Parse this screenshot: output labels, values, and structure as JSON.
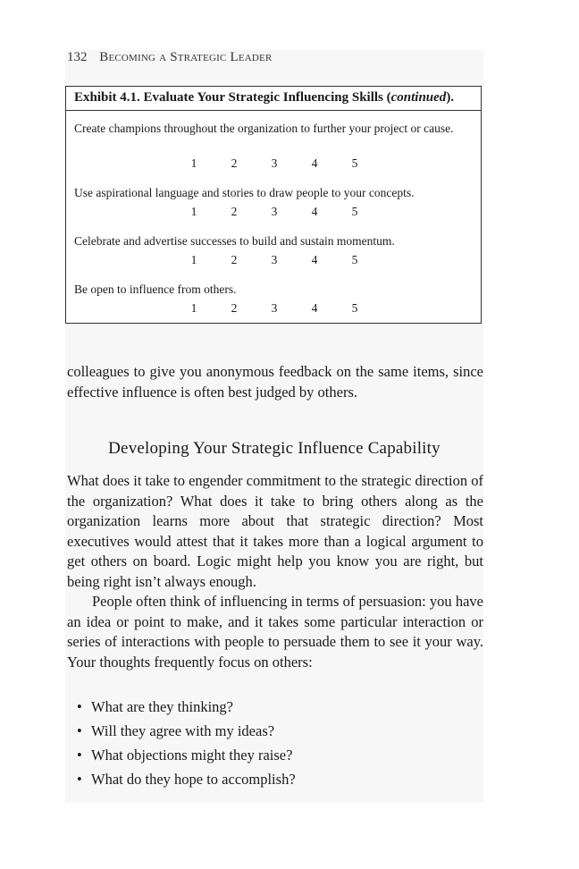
{
  "running_head": {
    "page_number": "132",
    "title": "Becoming a Strategic Leader"
  },
  "exhibit": {
    "title_main": "Exhibit 4.1.  Evaluate Your Strategic Influencing Skills (",
    "title_italic": "continued",
    "title_end": ").",
    "scale_labels": [
      "1",
      "2",
      "3",
      "4",
      "5"
    ],
    "items": [
      {
        "text": "Create champions throughout the organization to further your project or cause."
      },
      {
        "text": "Use aspirational language and stories to draw people to your concepts."
      },
      {
        "text": "Celebrate and advertise successes to build and sustain momentum."
      },
      {
        "text": "Be open to influence from others."
      }
    ]
  },
  "body": {
    "continuation": "colleagues to give you anonymous feedback on the same items, since effective influence is often best judged by others.",
    "section_heading": "Developing Your Strategic Influence Capability",
    "paragraph_1": "What does it take to engender commitment to the strategic direction of the organization? What does it take to bring others along as the organization learns more about that strategic direction? Most executives would attest that it takes more than a logical argument to get others on board. Logic might help you know you are right, but being right isn’t always enough.",
    "paragraph_2": "People often think of influencing in terms of persuasion: you have an idea or point to make, and it takes some particular interaction or series of interactions with people to persuade them to see it your way. Your thoughts frequently focus on others:",
    "bullets": [
      "What are they thinking?",
      "Will they agree with my ideas?",
      "What objections might they raise?",
      "What do they hope to accomplish?"
    ]
  }
}
